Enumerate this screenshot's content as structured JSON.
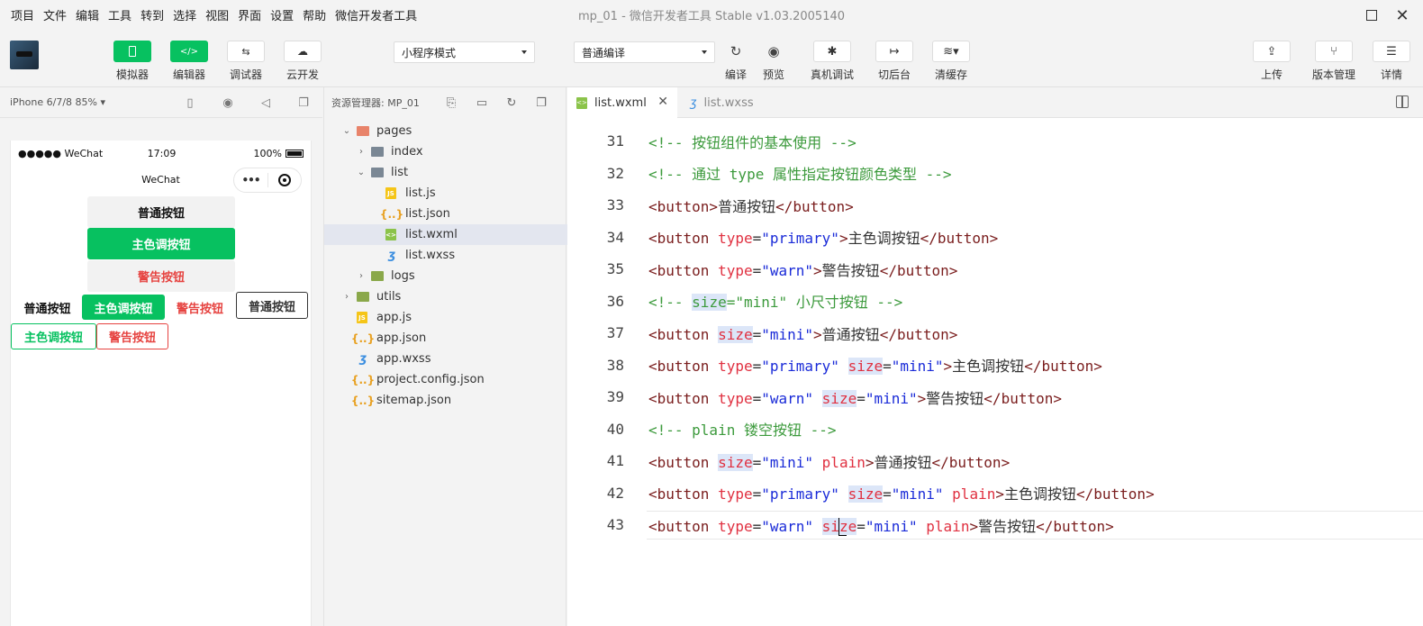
{
  "menubar": {
    "items": [
      "项目",
      "文件",
      "编辑",
      "工具",
      "转到",
      "选择",
      "视图",
      "界面",
      "设置",
      "帮助",
      "微信开发者工具"
    ],
    "title": "mp_01 - 微信开发者工具 Stable v1.03.2005140"
  },
  "toolbar": {
    "simulator": "模拟器",
    "editor": "编辑器",
    "debugger": "调试器",
    "cloud": "云开发",
    "mode_select": "小程序模式",
    "compile_select": "普通编译",
    "compile": "编译",
    "preview": "预览",
    "device_debug": "真机调试",
    "background": "切后台",
    "clear_cache": "清缓存",
    "upload": "上传",
    "version": "版本管理",
    "details": "详情"
  },
  "simulator": {
    "device": "iPhone 6/7/8 85% ▾",
    "status_left": "●●●●● WeChat",
    "status_time": "17:09",
    "status_battery": "100%",
    "nav_title": "WeChat",
    "capsule_dots": "•••",
    "buttons": {
      "default": "普通按钮",
      "primary": "主色调按钮",
      "warn": "警告按钮"
    }
  },
  "explorer": {
    "title": "资源管理器: MP_01",
    "nodes": [
      {
        "name": "pages",
        "type": "folder-pages",
        "level": 0,
        "open": true
      },
      {
        "name": "index",
        "type": "folder",
        "level": 1,
        "open": false
      },
      {
        "name": "list",
        "type": "folder",
        "level": 1,
        "open": true
      },
      {
        "name": "list.js",
        "type": "js",
        "level": 2
      },
      {
        "name": "list.json",
        "type": "json",
        "level": 2
      },
      {
        "name": "list.wxml",
        "type": "wxml",
        "level": 2,
        "active": true
      },
      {
        "name": "list.wxss",
        "type": "wxss",
        "level": 2
      },
      {
        "name": "logs",
        "type": "folder-logs",
        "level": 1,
        "open": false
      },
      {
        "name": "utils",
        "type": "folder-logs",
        "level": 0,
        "open": false
      },
      {
        "name": "app.js",
        "type": "js",
        "level": 0
      },
      {
        "name": "app.json",
        "type": "json",
        "level": 0
      },
      {
        "name": "app.wxss",
        "type": "wxss",
        "level": 0
      },
      {
        "name": "project.config.json",
        "type": "json",
        "level": 0
      },
      {
        "name": "sitemap.json",
        "type": "json",
        "level": 0
      }
    ]
  },
  "editor": {
    "tabs": [
      {
        "label": "list.wxml",
        "active": true
      },
      {
        "label": "list.wxss",
        "active": false
      }
    ],
    "lines": [
      {
        "num": "31",
        "tokens": [
          [
            "cm",
            "<!-- 按钮组件的基本使用 -->"
          ]
        ]
      },
      {
        "num": "32",
        "tokens": [
          [
            "cm",
            "<!-- 通过 type 属性指定按钮颜色类型 -->"
          ]
        ]
      },
      {
        "num": "33",
        "tokens": [
          [
            "tg",
            "<button>"
          ],
          [
            "",
            "普通按钮"
          ],
          [
            "tg",
            "</button>"
          ]
        ]
      },
      {
        "num": "34",
        "tokens": [
          [
            "tg",
            "<button "
          ],
          [
            "at",
            "type"
          ],
          [
            "",
            "="
          ],
          [
            "st",
            "\"primary\""
          ],
          [
            "tg",
            ">"
          ],
          [
            "",
            "主色调按钮"
          ],
          [
            "tg",
            "</button>"
          ]
        ]
      },
      {
        "num": "35",
        "tokens": [
          [
            "tg",
            "<button "
          ],
          [
            "at",
            "type"
          ],
          [
            "",
            "="
          ],
          [
            "st",
            "\"warn\""
          ],
          [
            "tg",
            ">"
          ],
          [
            "",
            "警告按钮"
          ],
          [
            "tg",
            "</button>"
          ]
        ]
      },
      {
        "num": "36",
        "tokens": [
          [
            "cm",
            "<!-- "
          ],
          [
            "cm hl",
            "size"
          ],
          [
            "cm",
            "=\"mini\" 小尺寸按钮 -->"
          ]
        ]
      },
      {
        "num": "37",
        "tokens": [
          [
            "tg",
            "<button "
          ],
          [
            "at hl",
            "size"
          ],
          [
            "",
            "="
          ],
          [
            "st",
            "\"mini\""
          ],
          [
            "tg",
            ">"
          ],
          [
            "",
            "普通按钮"
          ],
          [
            "tg",
            "</button>"
          ]
        ]
      },
      {
        "num": "38",
        "tokens": [
          [
            "tg",
            "<button "
          ],
          [
            "at",
            "type"
          ],
          [
            "",
            "="
          ],
          [
            "st",
            "\"primary\" "
          ],
          [
            "at hl",
            "size"
          ],
          [
            "",
            "="
          ],
          [
            "st",
            "\"mini\""
          ],
          [
            "tg",
            ">"
          ],
          [
            "",
            "主色调按钮"
          ],
          [
            "tg",
            "</button>"
          ]
        ]
      },
      {
        "num": "39",
        "tokens": [
          [
            "tg",
            "<button "
          ],
          [
            "at",
            "type"
          ],
          [
            "",
            "="
          ],
          [
            "st",
            "\"warn\" "
          ],
          [
            "at hl",
            "size"
          ],
          [
            "",
            "="
          ],
          [
            "st",
            "\"mini\""
          ],
          [
            "tg",
            ">"
          ],
          [
            "",
            "警告按钮"
          ],
          [
            "tg",
            "</button>"
          ]
        ]
      },
      {
        "num": "40",
        "tokens": [
          [
            "cm",
            "<!-- plain 镂空按钮 -->"
          ]
        ]
      },
      {
        "num": "41",
        "tokens": [
          [
            "tg",
            "<button "
          ],
          [
            "at hl",
            "size"
          ],
          [
            "",
            "="
          ],
          [
            "st",
            "\"mini\" "
          ],
          [
            "at",
            "plain"
          ],
          [
            "tg",
            ">"
          ],
          [
            "",
            "普通按钮"
          ],
          [
            "tg",
            "</button>"
          ]
        ]
      },
      {
        "num": "42",
        "tokens": [
          [
            "tg",
            "<button "
          ],
          [
            "at",
            "type"
          ],
          [
            "",
            "="
          ],
          [
            "st",
            "\"primary\" "
          ],
          [
            "at hl",
            "size"
          ],
          [
            "",
            "="
          ],
          [
            "st",
            "\"mini\" "
          ],
          [
            "at",
            "plain"
          ],
          [
            "tg",
            ">"
          ],
          [
            "",
            "主色调按钮"
          ],
          [
            "tg",
            "</button>"
          ]
        ]
      },
      {
        "num": "43",
        "tokens": [
          [
            "tg",
            "<button "
          ],
          [
            "at",
            "type"
          ],
          [
            "",
            "="
          ],
          [
            "st",
            "\"warn\" "
          ],
          [
            "at hl",
            "si"
          ],
          [
            "cursor",
            ""
          ],
          [
            "at hl",
            "ze"
          ],
          [
            "",
            "="
          ],
          [
            "st",
            "\"mini\" "
          ],
          [
            "at",
            "plain"
          ],
          [
            "tg",
            ">"
          ],
          [
            "",
            "警告按钮"
          ],
          [
            "tg",
            "</button>"
          ]
        ],
        "current": true
      }
    ]
  },
  "colors": {
    "accent_green": "#07c160",
    "warn_red": "#e64340"
  }
}
